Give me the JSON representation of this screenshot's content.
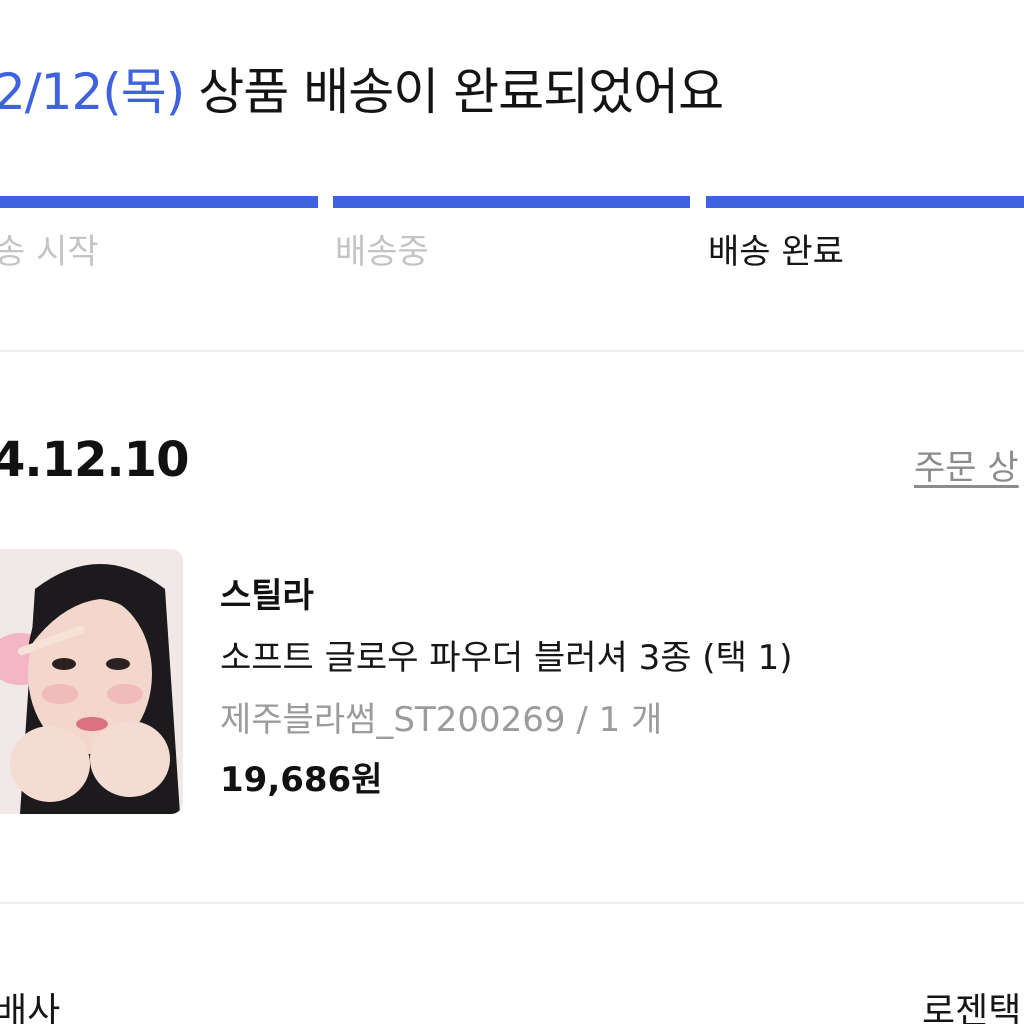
{
  "delivery": {
    "date": "2/12(목)",
    "message": "상품 배송이 완료되었어요",
    "progress_fraction": 1.0,
    "accent_color": "#3f63e0",
    "steps": [
      {
        "label": "송 시작",
        "active": false
      },
      {
        "label": "배송중",
        "active": false
      },
      {
        "label": "배송 완료",
        "active": true
      }
    ]
  },
  "order": {
    "date": "4.12.10",
    "detail_link": "주문 상",
    "product": {
      "image_icon": "product-photo",
      "brand": "스틸라",
      "name": "소프트 글로우 파우더 블러셔 3종 (택 1)",
      "option": "제주블라썸_ST200269 / 1 개",
      "price": "19,686원"
    }
  },
  "shipping": {
    "courier_label": "배사",
    "courier_value": "로젠택"
  }
}
